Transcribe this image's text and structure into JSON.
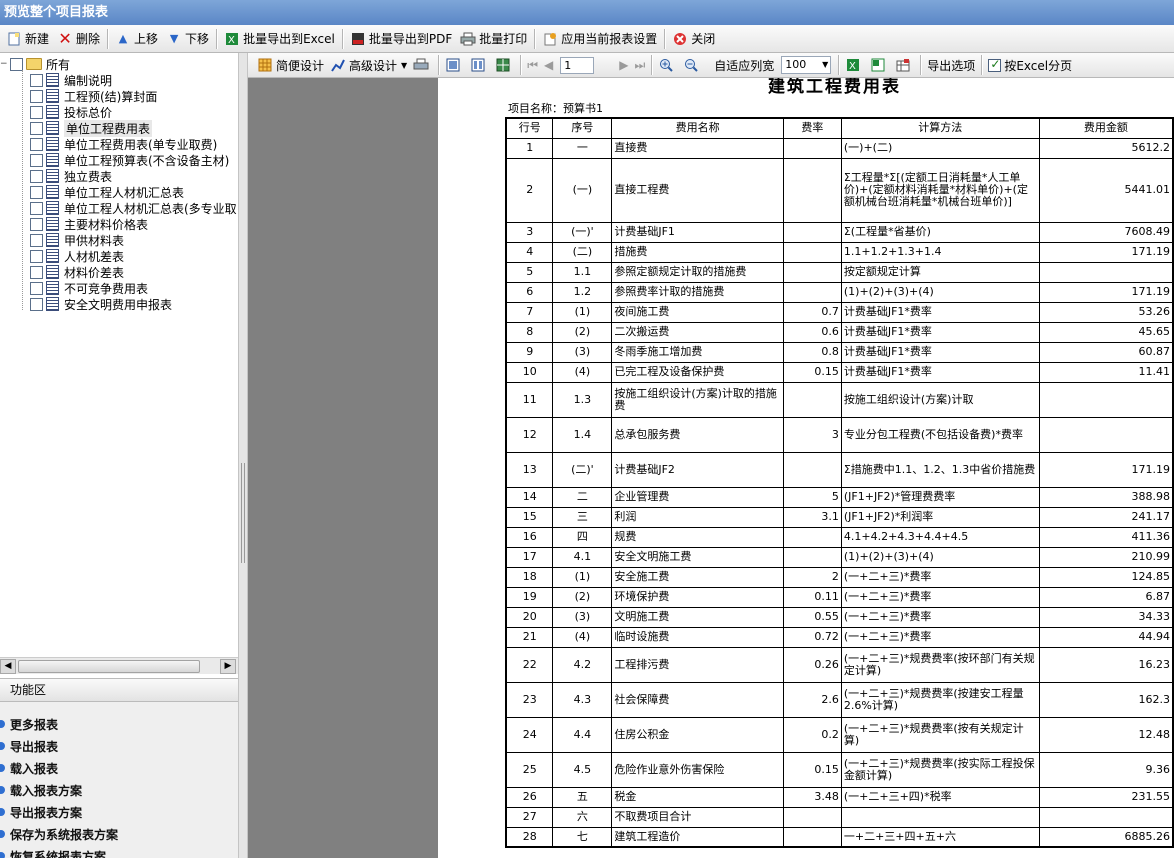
{
  "window_title": "预览整个项目报表",
  "toolbar": [
    {
      "label": "新建",
      "icon": "new-icon"
    },
    {
      "label": "删除",
      "icon": "delete-icon"
    },
    {
      "label": "上移",
      "icon": "arrow-up-icon"
    },
    {
      "label": "下移",
      "icon": "arrow-down-icon"
    },
    {
      "label": "批量导出到Excel",
      "icon": "excel-icon"
    },
    {
      "label": "批量导出到PDF",
      "icon": "pdf-icon"
    },
    {
      "label": "批量打印",
      "icon": "printer-icon"
    },
    {
      "label": "应用当前报表设置",
      "icon": "apply-settings-icon"
    },
    {
      "label": "关闭",
      "icon": "close-icon"
    }
  ],
  "tree": {
    "root": "所有",
    "items": [
      "编制说明",
      "工程预(结)算封面",
      "投标总价",
      "单位工程费用表",
      "单位工程费用表(单专业取费)",
      "单位工程预算表(不含设备主材)",
      "独立费表",
      "单位工程人材机汇总表",
      "单位工程人材机汇总表(多专业取",
      "主要材料价格表",
      "甲供材料表",
      "人材机差表",
      "材料价差表",
      "不可竞争费用表",
      "安全文明费用申报表"
    ],
    "selected_index": 3
  },
  "function_area": {
    "title": "功能区",
    "items": [
      "更多报表",
      "导出报表",
      "载入报表",
      "载入报表方案",
      "导出报表方案",
      "保存为系统报表方案",
      "恢复系统报表方案"
    ]
  },
  "viewer_toolbar": {
    "simple_design": "简便设计",
    "advanced_design": "高级设计",
    "page_number": "1",
    "auto_fit": "自适应列宽",
    "zoom": "100",
    "export_options": "导出选项",
    "excel_paging": "按Excel分页",
    "excel_paging_checked": true
  },
  "report": {
    "title": "建筑工程费用表",
    "project_name": "项目名称：预算书1",
    "columns": [
      "行号",
      "序号",
      "费用名称",
      "费率",
      "计算方法",
      "费用金额"
    ],
    "rows": [
      [
        "1",
        "一",
        "直接费",
        "",
        "(一)+(二)",
        "5612.2"
      ],
      [
        "2",
        "(一)",
        "直接工程费",
        "",
        "Σ工程量*Σ[(定额工日消耗量*人工单价)+(定额材料消耗量*材料单价)+(定额机械台班消耗量*机械台班单价)]",
        "5441.01"
      ],
      [
        "3",
        "(一)'",
        "计费基础JF1",
        "",
        "Σ(工程量*省基价)",
        "7608.49"
      ],
      [
        "4",
        "(二)",
        "措施费",
        "",
        "1.1+1.2+1.3+1.4",
        "171.19"
      ],
      [
        "5",
        "1.1",
        "参照定额规定计取的措施费",
        "",
        "按定额规定计算",
        ""
      ],
      [
        "6",
        "1.2",
        "参照费率计取的措施费",
        "",
        "(1)+(2)+(3)+(4)",
        "171.19"
      ],
      [
        "7",
        "(1)",
        "夜间施工费",
        "0.7",
        "计费基础JF1*费率",
        "53.26"
      ],
      [
        "8",
        "(2)",
        "二次搬运费",
        "0.6",
        "计费基础JF1*费率",
        "45.65"
      ],
      [
        "9",
        "(3)",
        "冬雨季施工增加费",
        "0.8",
        "计费基础JF1*费率",
        "60.87"
      ],
      [
        "10",
        "(4)",
        "已完工程及设备保护费",
        "0.15",
        "计费基础JF1*费率",
        "11.41"
      ],
      [
        "11",
        "1.3",
        "按施工组织设计(方案)计取的措施费",
        "",
        "按施工组织设计(方案)计取",
        ""
      ],
      [
        "12",
        "1.4",
        "总承包服务费",
        "3",
        "专业分包工程费(不包括设备费)*费率",
        ""
      ],
      [
        "13",
        "(二)'",
        "计费基础JF2",
        "",
        "Σ措施费中1.1、1.2、1.3中省价措施费",
        "171.19"
      ],
      [
        "14",
        "二",
        "企业管理费",
        "5",
        "(JF1+JF2)*管理费费率",
        "388.98"
      ],
      [
        "15",
        "三",
        "利润",
        "3.1",
        "(JF1+JF2)*利润率",
        "241.17"
      ],
      [
        "16",
        "四",
        "规费",
        "",
        "4.1+4.2+4.3+4.4+4.5",
        "411.36"
      ],
      [
        "17",
        "4.1",
        "安全文明施工费",
        "",
        "(1)+(2)+(3)+(4)",
        "210.99"
      ],
      [
        "18",
        "(1)",
        "安全施工费",
        "2",
        "(一+二+三)*费率",
        "124.85"
      ],
      [
        "19",
        "(2)",
        "环境保护费",
        "0.11",
        "(一+二+三)*费率",
        "6.87"
      ],
      [
        "20",
        "(3)",
        "文明施工费",
        "0.55",
        "(一+二+三)*费率",
        "34.33"
      ],
      [
        "21",
        "(4)",
        "临时设施费",
        "0.72",
        "(一+二+三)*费率",
        "44.94"
      ],
      [
        "22",
        "4.2",
        "工程排污费",
        "0.26",
        "(一+二+三)*规费费率(按环部门有关规定计算)",
        "16.23"
      ],
      [
        "23",
        "4.3",
        "社会保障费",
        "2.6",
        "(一+二+三)*规费费率(按建安工程量2.6%计算)",
        "162.3"
      ],
      [
        "24",
        "4.4",
        "住房公积金",
        "0.2",
        "(一+二+三)*规费费率(按有关规定计算)",
        "12.48"
      ],
      [
        "25",
        "4.5",
        "危险作业意外伤害保险",
        "0.15",
        "(一+二+三)*规费费率(按实际工程投保金额计算)",
        "9.36"
      ],
      [
        "26",
        "五",
        "税金",
        "3.48",
        "(一+二+三+四)*税率",
        "231.55"
      ],
      [
        "27",
        "六",
        "不取费项目合计",
        "",
        "",
        ""
      ],
      [
        "28",
        "七",
        "建筑工程造价",
        "",
        "一+二+三+四+五+六",
        "6885.26"
      ]
    ],
    "row_heights": [
      20,
      20,
      64,
      20,
      20,
      20,
      20,
      20,
      20,
      20,
      20,
      35,
      35,
      35,
      20,
      20,
      20,
      20,
      20,
      20,
      20,
      20,
      35,
      35,
      35,
      35,
      20,
      20,
      20
    ]
  }
}
